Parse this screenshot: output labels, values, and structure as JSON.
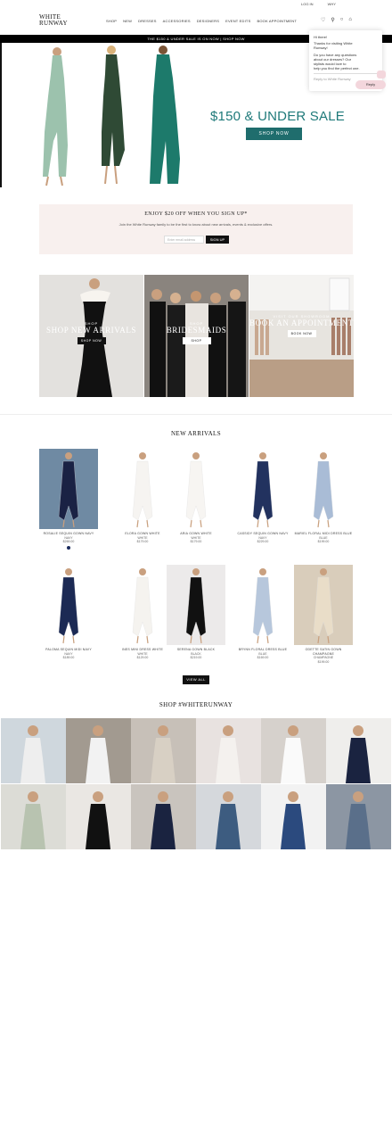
{
  "topbar": {
    "left_link": "LOG IN",
    "right_link": "WHY"
  },
  "brand": {
    "logo_line1": "WHITE",
    "logo_line2": "RUNWAY"
  },
  "nav": {
    "items": [
      "SHOP",
      "NEW",
      "DRESSES",
      "ACCESSORIES",
      "DESIGNERS",
      "EVENT EDITS",
      "BOOK APPOINTMENT"
    ]
  },
  "announcement": "THE $150 & UNDER SALE IS ON NOW | SHOP NOW",
  "popup": {
    "greeting": "Hi there!",
    "line1": "Thanks for visiting White",
    "line2": "Runway!",
    "line3": "Do you have any questions",
    "line4": "about our dresses? Our",
    "line5": "stylists would love to",
    "line6": "help you find the perfect one.",
    "reply_placeholder": "Reply to White Runway",
    "chat_button": "Reply"
  },
  "hero": {
    "sale_title": "$150 & UNDER SALE",
    "cta": "SHOP NOW",
    "colors": {
      "teal": "#1f6d6d",
      "title": "#1f7a7a"
    }
  },
  "signup": {
    "heading": "ENJOY $20 OFF WHEN YOU SIGN UP*",
    "subtext": "Join the White Runway family to be the first to know about new arrivals, events & exclusive offers.",
    "email_placeholder": "Enter email address",
    "button": "SIGN UP"
  },
  "tiles": [
    {
      "kicker": "SHOP",
      "title": "SHOP NEW ARRIVALS",
      "button": "SHOP NOW"
    },
    {
      "kicker": "SHOP",
      "title": "BRIDESMAIDS",
      "button": "SHOP"
    },
    {
      "kicker": "VISIT OUR SHOWROOM",
      "title": "BOOK AN APPOINTMENT",
      "button": "BOOK NOW"
    }
  ],
  "new_arrivals": {
    "title": "NEW ARRIVALS",
    "view_all": "VIEW ALL",
    "products": [
      {
        "name": "ROSALIE SEQUIN GOWN NAVY",
        "color": "NAVY",
        "price": "$269.00",
        "dress": "#1a2244",
        "bg": "#6f8aa3",
        "has_dot": true
      },
      {
        "name": "ELORA GOWN WHITE",
        "color": "WHITE",
        "price": "$179.00",
        "dress": "#f6f4f1",
        "bg": "#fff",
        "has_dot": false
      },
      {
        "name": "ARIA GOWN WHITE",
        "color": "WHITE",
        "price": "$179.00",
        "dress": "#f7f5f2",
        "bg": "#fff",
        "has_dot": false
      },
      {
        "name": "CASSIDY SEQUIN GOWN NAVY",
        "color": "NAVY",
        "price": "$229.00",
        "dress": "#22325f",
        "bg": "#fff",
        "has_dot": false
      },
      {
        "name": "MARIEL FLORAL MIDI DRESS BLUE",
        "color": "BLUE",
        "price": "$199.00",
        "dress": "#a9bcd6",
        "bg": "#fff",
        "has_dot": false
      },
      {
        "name": "PALOMA SEQUIN MIDI NAVY",
        "color": "NAVY",
        "price": "$189.00",
        "dress": "#1c2a54",
        "bg": "#fff",
        "has_dot": false
      },
      {
        "name": "INES MINI DRESS WHITE",
        "color": "WHITE",
        "price": "$129.00",
        "dress": "#f5f3ef",
        "bg": "#fff",
        "has_dot": false
      },
      {
        "name": "SERENA GOWN BLACK",
        "color": "BLACK",
        "price": "$219.00",
        "dress": "#111111",
        "bg": "#eceaea",
        "has_dot": false
      },
      {
        "name": "BRYNN FLORAL DRESS BLUE",
        "color": "BLUE",
        "price": "$169.00",
        "dress": "#b7c7dc",
        "bg": "#fff",
        "has_dot": false
      },
      {
        "name": "ODETTE SATIN GOWN CHAMPAGNE",
        "color": "CHAMPAGNE",
        "price": "$199.00",
        "dress": "#e9ddc8",
        "bg": "#d9cdbb",
        "has_dot": false
      }
    ]
  },
  "instagram": {
    "title": "SHOP #WHITERUNWAY",
    "tiles": [
      {
        "bg": "#cfd7dd",
        "dress": "#eeeeee"
      },
      {
        "bg": "#a29a90",
        "dress": "#f2f2f2"
      },
      {
        "bg": "#c7c0b8",
        "dress": "#d8d0c4"
      },
      {
        "bg": "#e8e2e0",
        "dress": "#f4f1ee"
      },
      {
        "bg": "#d6d1cc",
        "dress": "#fafafa"
      },
      {
        "bg": "#efeeec",
        "dress": "#1a2340"
      },
      {
        "bg": "#dcdcd6",
        "dress": "#b8c3b0"
      },
      {
        "bg": "#eae7e3",
        "dress": "#111111"
      },
      {
        "bg": "#c9c4be",
        "dress": "#1a2340"
      },
      {
        "bg": "#d5d8dc",
        "dress": "#3d5c80"
      },
      {
        "bg": "#f2f2f2",
        "dress": "#2b4a7e"
      },
      {
        "bg": "#8c96a3",
        "dress": "#5a6f8a"
      }
    ]
  }
}
